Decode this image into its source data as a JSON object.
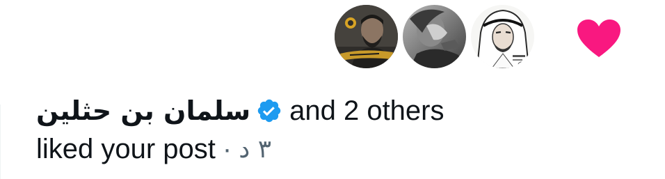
{
  "notification": {
    "user_name": "سلمان بن حثلين",
    "others_text": "and 2 others",
    "action_text": "liked your post",
    "separator": "·",
    "time_ago": "٣ د"
  },
  "icons": {
    "like": "heart-icon",
    "verified": "verified-badge-icon"
  },
  "colors": {
    "like": "#f91880",
    "verified": "#1d9bf0",
    "text": "#0f1419",
    "secondary": "#536471"
  }
}
